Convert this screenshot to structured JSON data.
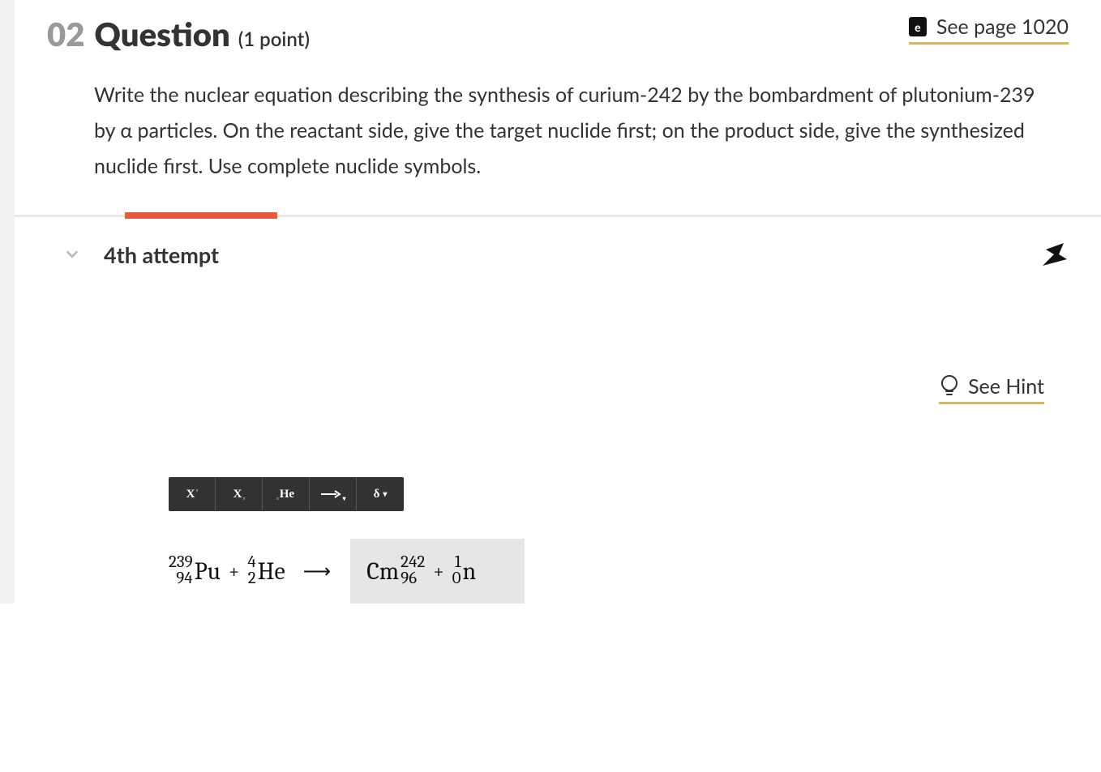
{
  "header": {
    "number": "02",
    "title": "Question",
    "points": "(1 point)",
    "seePage": "See page 1020",
    "bookLetter": "e"
  },
  "prompt": "Write the nuclear equation describing the synthesis of curium-242 by the bombardment of plutonium-239 by α particles. On the reactant side, give the target nuclide first; on the product side, give the synthesized nuclide first. Use complete nuclide symbols.",
  "attempt": {
    "label": "4th attempt"
  },
  "hint": {
    "label": "See Hint"
  },
  "toolbar": {
    "xSup": "X",
    "xSub": "X",
    "he": "He",
    "delta": "δ"
  },
  "equation": {
    "reactant1": {
      "mass": "239",
      "atomic": "94",
      "symbol": "Pu"
    },
    "plus": "+",
    "reactant2": {
      "mass": "4",
      "atomic": "2",
      "symbol": "He"
    },
    "arrow": "⟶",
    "product1": {
      "symbol": "Cm",
      "mass": "242",
      "atomic": "96"
    },
    "product2": {
      "mass": "1",
      "atomic": "0",
      "symbol": "n"
    }
  }
}
